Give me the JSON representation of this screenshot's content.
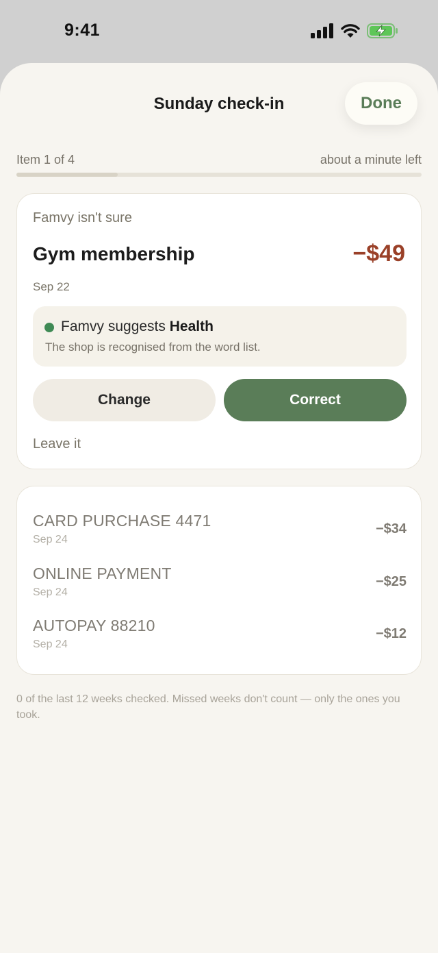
{
  "status_bar": {
    "time": "9:41",
    "icons": [
      "signal-icon",
      "wifi-icon",
      "battery-charging-icon"
    ]
  },
  "header": {
    "title": "Sunday check-in",
    "done_label": "Done"
  },
  "progress": {
    "label": "Item 1 of 4",
    "remaining": "about a minute left",
    "fraction": 0.25
  },
  "current_item": {
    "uncertain_label": "Famvy isn't sure",
    "merchant": "Gym membership",
    "amount": "−$49",
    "date": "Sep 22",
    "suggestion_prefix": "Famvy suggests",
    "suggestion_category": "Health",
    "suggestion_reason": "The shop is recognised from the word list.",
    "change_label": "Change",
    "correct_label": "Correct",
    "leave_label": "Leave it"
  },
  "queue": [
    {
      "name": "CARD PURCHASE 4471",
      "date": "Sep 24",
      "amount": "−$34"
    },
    {
      "name": "ONLINE PAYMENT",
      "date": "Sep 24",
      "amount": "−$25"
    },
    {
      "name": "AUTOPAY 88210",
      "date": "Sep 24",
      "amount": "−$12"
    }
  ],
  "footer_note": "0 of the last 12 weeks checked. Missed weeks don't count — only the ones you took.",
  "colors": {
    "accent": "#5a7d58",
    "amount_negative": "#9a4028",
    "suggest_dot": "#3f8a55",
    "sheet_bg": "#f7f5f0"
  }
}
